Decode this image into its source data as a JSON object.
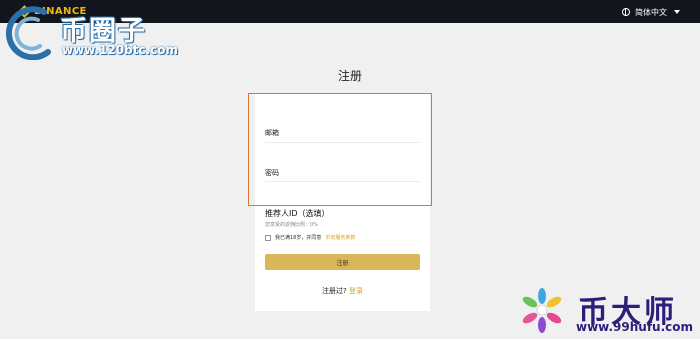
{
  "topbar": {
    "brand": "BINANCE",
    "language": "简体中文"
  },
  "page": {
    "title": "注册"
  },
  "form": {
    "email_label": "邮箱",
    "password_label": "密码",
    "referral_label": "推荐人ID（选填）",
    "referral_hint": "您享受的返佣比例：0%",
    "agree_text": "我已满18岁，并同意",
    "agree_link": "币安服务条款",
    "submit_label": "注册",
    "login_prompt": "注册过?",
    "login_link": "登录"
  },
  "watermarks": {
    "top_left_text": "币圈子",
    "top_left_url": "www.120btc.com",
    "bottom_right_text": "币大师",
    "bottom_right_url": "www.99hufu.com"
  },
  "colors": {
    "topbar": "#12161c",
    "brand": "#f0b90b",
    "accent_button": "#d7b75a",
    "link": "#d39e22",
    "highlight_border": "#d9763a"
  }
}
